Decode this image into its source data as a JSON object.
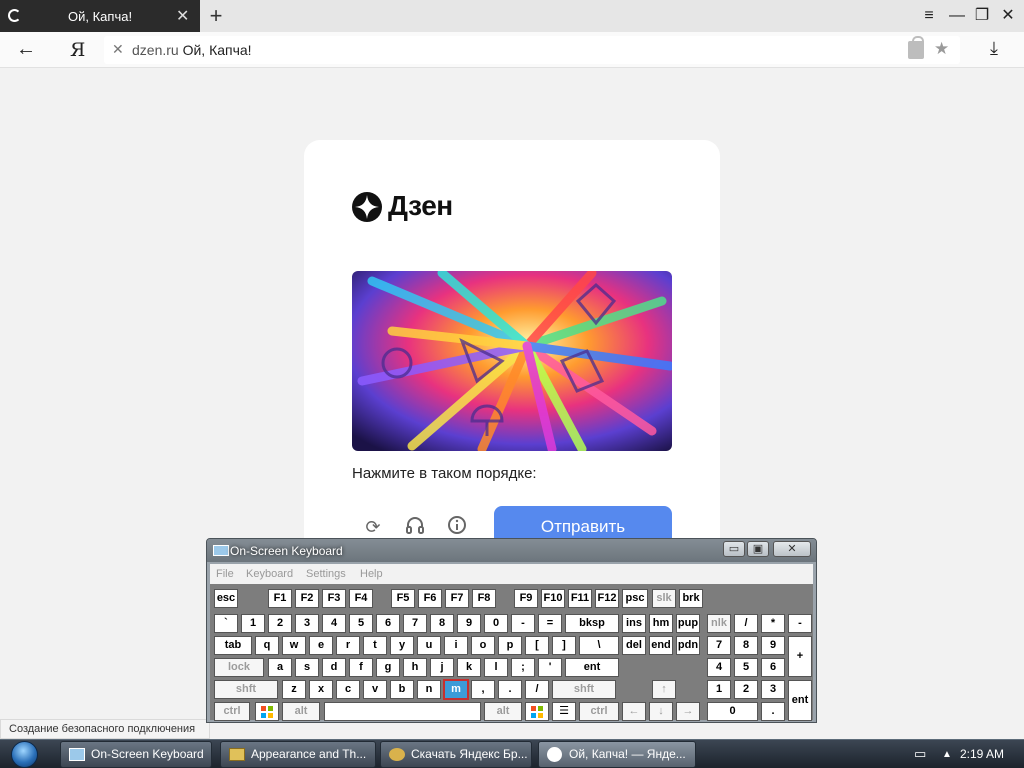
{
  "browser": {
    "tab_title": "Ой, Капча!",
    "new_tab_symbol": "+",
    "back_symbol": "←",
    "yandex_logo": "Я",
    "url_domain": "dzen.ru",
    "url_title": "Ой, Капча!",
    "status_text": "Создание безопасного подключения"
  },
  "page": {
    "brand": "Дзен",
    "prompt": "Нажмите в таком порядке:",
    "submit_label": "Отправить",
    "controls": [
      "refresh-icon",
      "headphones-icon",
      "info-icon"
    ]
  },
  "osk": {
    "title": "On-Screen Keyboard",
    "menu": [
      "File",
      "Keyboard",
      "Settings",
      "Help"
    ],
    "highlighted_key": "m",
    "fkeys": [
      "esc",
      "F1",
      "F2",
      "F3",
      "F4",
      "F5",
      "F6",
      "F7",
      "F8",
      "F9",
      "F10",
      "F11",
      "F12",
      "psc",
      "slk",
      "brk"
    ],
    "row1": [
      "`",
      "1",
      "2",
      "3",
      "4",
      "5",
      "6",
      "7",
      "8",
      "9",
      "0",
      "-",
      "=",
      "bksp",
      "ins",
      "hm",
      "pup",
      "nlk",
      "/",
      "*",
      "-"
    ],
    "row2": [
      "tab",
      "q",
      "w",
      "e",
      "r",
      "t",
      "y",
      "u",
      "i",
      "o",
      "p",
      "[",
      "]",
      "\\",
      "del",
      "end",
      "pdn",
      "7",
      "8",
      "9",
      "+"
    ],
    "row3": [
      "lock",
      "a",
      "s",
      "d",
      "f",
      "g",
      "h",
      "j",
      "k",
      "l",
      ";",
      "'",
      "ent",
      "4",
      "5",
      "6"
    ],
    "row4": [
      "shft",
      "z",
      "x",
      "c",
      "v",
      "b",
      "n",
      "m",
      ",",
      ".",
      "/",
      "shft",
      "↑",
      "1",
      "2",
      "3",
      "ent"
    ],
    "row5": [
      "ctrl",
      "alt",
      "alt",
      "ctrl",
      "←",
      "↓",
      "→",
      "0",
      "."
    ]
  },
  "taskbar": {
    "items": [
      "On-Screen Keyboard",
      "Appearance and Th...",
      "Скачать Яндекс Бр...",
      "Ой, Капча! — Янде..."
    ],
    "clock": "2:19 AM"
  },
  "colors": {
    "submit": "#5689ee",
    "osk_highlight": "#3c9bd8"
  }
}
